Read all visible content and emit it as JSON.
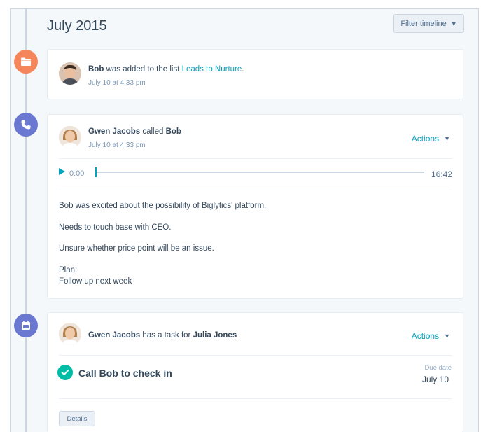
{
  "timeline": {
    "month": "July 2015",
    "filter_label": "Filter timeline"
  },
  "events": {
    "list_add": {
      "actor": "Bob",
      "text": " was added to the list ",
      "list_name": "Leads to Nurture",
      "period": ".",
      "timestamp": "July 10 at 4:33 pm",
      "icon": "folder-icon"
    },
    "call": {
      "caller": "Gwen Jacobs",
      "verb": " called ",
      "callee": "Bob",
      "timestamp": "July 10 at 4:33 pm",
      "actions_label": "Actions",
      "icon": "phone-icon",
      "audio": {
        "current_time": "0:00",
        "duration": "16:42",
        "progress": 0
      },
      "notes": {
        "line1": "Bob was excited about the possibility of Biglytics' platform.",
        "line2": "Needs to touch base with CEO.",
        "line3": "Unsure whether price point will be an issue.",
        "line4": "Plan:",
        "line5": "Follow up next week"
      }
    },
    "task": {
      "owner": "Gwen Jacobs",
      "text": " has a task for ",
      "assignee": "Julia Jones",
      "actions_label": "Actions",
      "icon": "calendar-icon",
      "title": "Call Bob  to check in",
      "due_label": "Due date",
      "due_value": "July 10",
      "details_label": "Details"
    }
  },
  "colors": {
    "accent": "#00a4bd",
    "orange": "#f5865b",
    "purple": "#6a78d1",
    "success": "#00bda5"
  }
}
